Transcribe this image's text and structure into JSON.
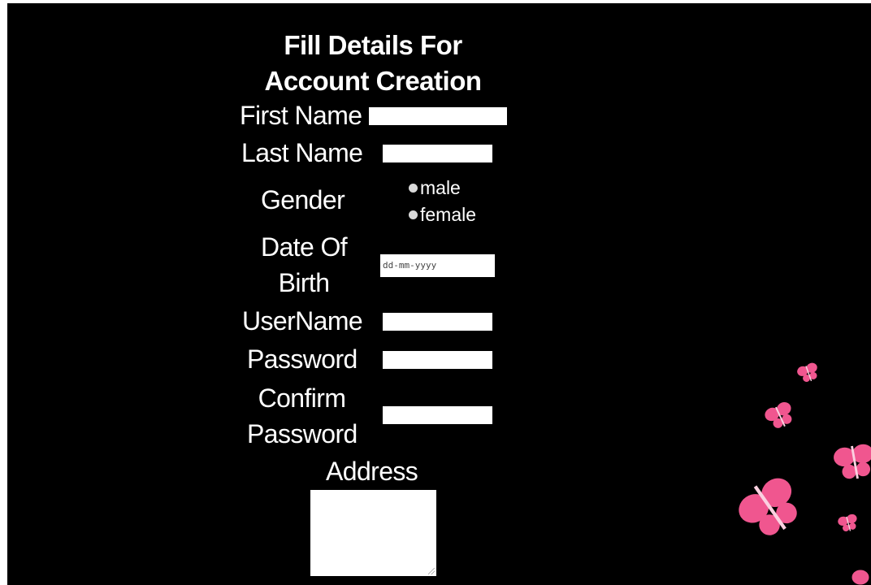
{
  "form": {
    "title_line1": "Fill Details For",
    "title_line2": "Account Creation",
    "labels": {
      "first_name": "First Name",
      "last_name": "Last Name",
      "gender": "Gender",
      "dob_line1": "Date Of",
      "dob_line2": "Birth",
      "username": "UserName",
      "password": "Password",
      "confirm_line1": "Confirm",
      "confirm_line2": "Password",
      "address": "Address"
    },
    "gender_options": [
      "male",
      "female"
    ],
    "dob_placeholder": "dd-mm-yyyy"
  },
  "colors": {
    "background": "#000000",
    "text": "#ffffff",
    "butterfly": "#f0568f"
  },
  "decorations": {
    "butterfly_icon": "butterfly-icon"
  }
}
